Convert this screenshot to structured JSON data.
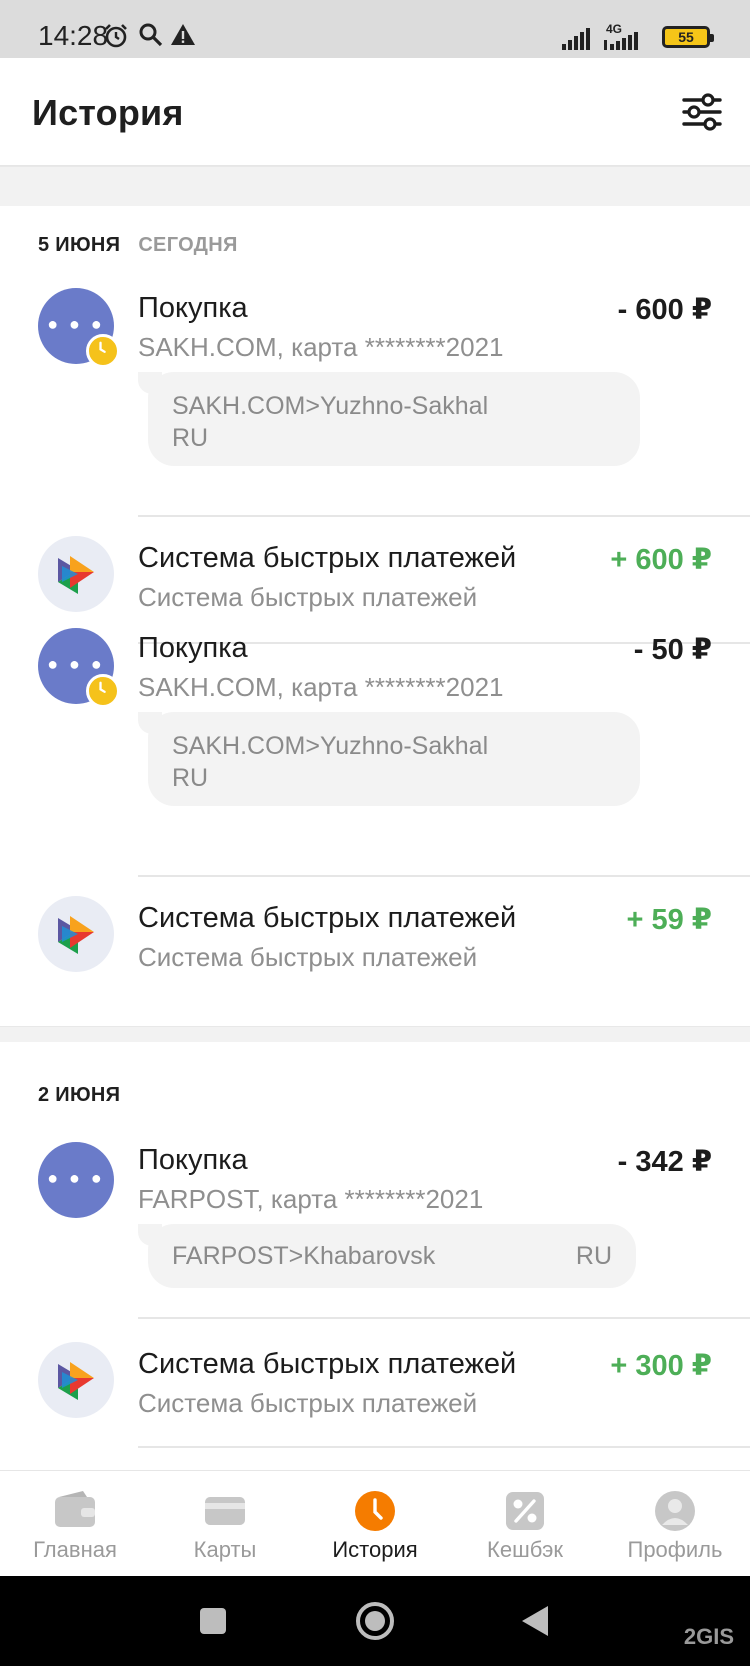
{
  "status_bar": {
    "time": "14:28",
    "battery": "55",
    "network": "4G"
  },
  "header": {
    "title": "История"
  },
  "groups": [
    {
      "date": "5 ИЮНЯ",
      "date_note": "СЕГОДНЯ",
      "transactions": [
        {
          "type": "purchase",
          "title": "Покупка",
          "subtitle": "SAKH.COM, карта ********2021",
          "amount": "- 600 ₽",
          "sign": "negative",
          "pending": true,
          "details": [
            "SAKH.COM>Yuzhno-Sakhal",
            "RU"
          ]
        },
        {
          "type": "sbp",
          "title": "Система быстрых платежей",
          "subtitle": "Система быстрых платежей",
          "amount": "+ 600 ₽",
          "sign": "positive"
        },
        {
          "type": "purchase",
          "title": "Покупка",
          "subtitle": "SAKH.COM, карта ********2021",
          "amount": "- 50 ₽",
          "sign": "negative",
          "pending": true,
          "details": [
            "SAKH.COM>Yuzhno-Sakhal",
            "RU"
          ]
        },
        {
          "type": "sbp",
          "title": "Система быстрых платежей",
          "subtitle": "Система быстрых платежей",
          "amount": "+ 59 ₽",
          "sign": "positive"
        }
      ]
    },
    {
      "date": "2 ИЮНЯ",
      "transactions": [
        {
          "type": "purchase",
          "title": "Покупка",
          "subtitle": "FARPOST, карта ********2021",
          "amount": "- 342 ₽",
          "sign": "negative",
          "pending": false,
          "details_left": "FARPOST>Khabarovsk",
          "details_right": "RU"
        },
        {
          "type": "sbp",
          "title": "Система быстрых платежей",
          "subtitle": "Система быстрых платежей",
          "amount": "+ 300 ₽",
          "sign": "positive"
        }
      ]
    }
  ],
  "bottom_nav": [
    {
      "label": "Главная",
      "icon": "wallet-icon"
    },
    {
      "label": "Карты",
      "icon": "card-icon"
    },
    {
      "label": "История",
      "icon": "clock-icon",
      "active": true
    },
    {
      "label": "Кешбэк",
      "icon": "percent-icon"
    },
    {
      "label": "Профиль",
      "icon": "user-icon"
    }
  ],
  "watermark": "2GIS",
  "colors": {
    "accent": "#f57c00",
    "positive": "#4dae57",
    "avatar_purchase": "#6a7bc9",
    "pending_badge": "#f5c21b"
  }
}
